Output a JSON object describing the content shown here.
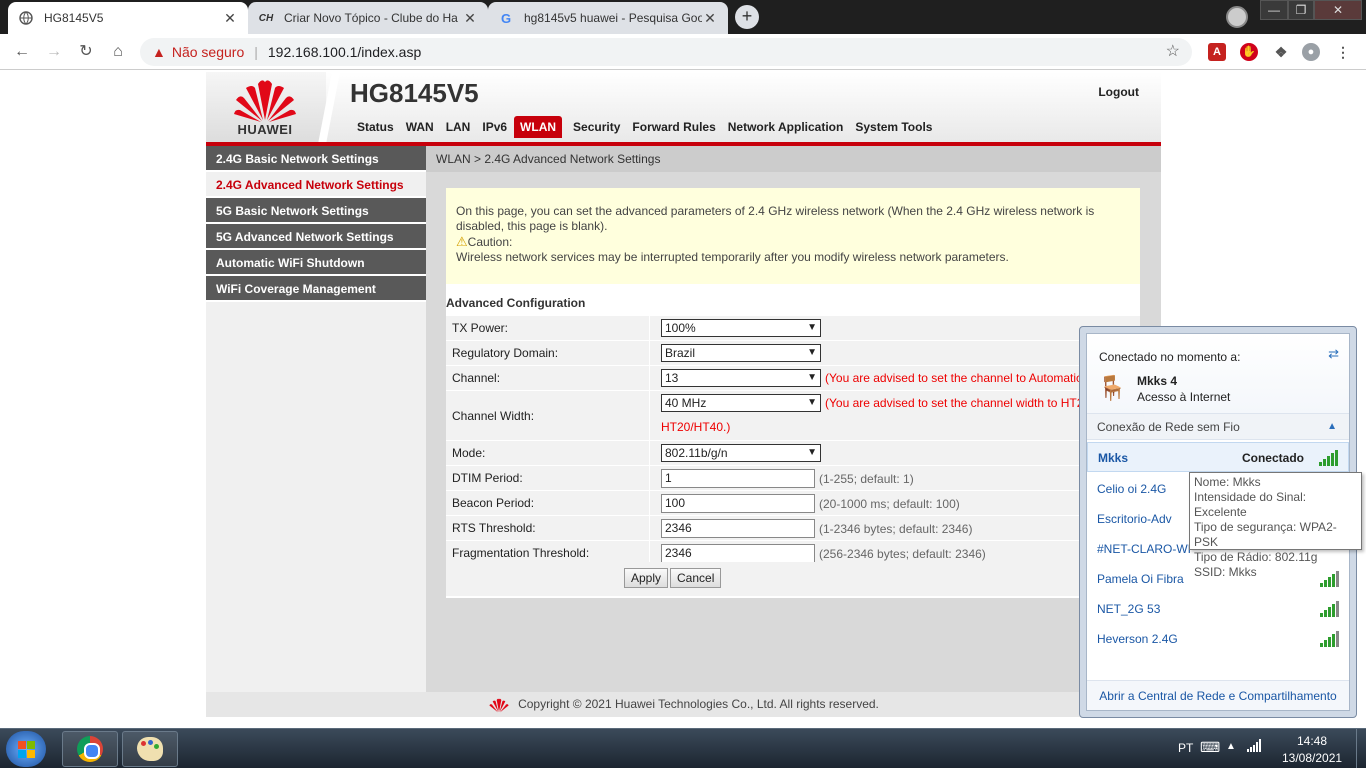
{
  "browser": {
    "tabs": [
      {
        "title": "HG8145V5",
        "favicon": "globe-icon"
      },
      {
        "title": "Criar Novo Tópico - Clube do Ha",
        "favicon_text": "CH"
      },
      {
        "title": "hg8145v5 huawei - Pesquisa Goo",
        "favicon_text": "G"
      }
    ],
    "new_tab": "+",
    "close": "✕",
    "security_label": "Não seguro",
    "url": "192.168.100.1/index.asp"
  },
  "router": {
    "brand": "HUAWEI",
    "model": "HG8145V5",
    "logout": "Logout",
    "nav": [
      "Status",
      "WAN",
      "LAN",
      "IPv6",
      "WLAN",
      "Security",
      "Forward Rules",
      "Network Application",
      "System Tools"
    ],
    "sidebar": [
      "2.4G Basic Network Settings",
      "2.4G Advanced Network Settings",
      "5G Basic Network Settings",
      "5G Advanced Network Settings",
      "Automatic WiFi Shutdown",
      "WiFi Coverage Management"
    ],
    "breadcrumb": "WLAN > 2.4G Advanced Network Settings",
    "notice": {
      "text": "On this page, you can set the advanced parameters of 2.4 GHz wireless network (When the 2.4 GHz wireless network is disabled, this page is blank).",
      "caution_label": "Caution:",
      "caution_text": "Wireless network services may be interrupted temporarily after you modify wireless network parameters."
    },
    "section_title": "Advanced Configuration",
    "fields": {
      "tx_power": {
        "label": "TX Power:",
        "value": "100%"
      },
      "regulatory": {
        "label": "Regulatory Domain:",
        "value": "Brazil"
      },
      "channel": {
        "label": "Channel:",
        "value": "13",
        "hint": "(You are advised to set the channel to Automatic"
      },
      "channel_width": {
        "label": "Channel Width:",
        "value": "40 MHz",
        "hint": "(You are advised to set the channel width to HT2",
        "hint2": "HT20/HT40.)"
      },
      "mode": {
        "label": "Mode:",
        "value": "802.11b/g/n"
      },
      "dtim": {
        "label": "DTIM Period:",
        "value": "1",
        "hint": "(1-255; default: 1)"
      },
      "beacon": {
        "label": "Beacon Period:",
        "value": "100",
        "hint": "(20-1000 ms; default: 100)"
      },
      "rts": {
        "label": "RTS Threshold:",
        "value": "2346",
        "hint": "(1-2346 bytes; default: 2346)"
      },
      "frag": {
        "label": "Fragmentation Threshold:",
        "value": "2346",
        "hint": "(256-2346 bytes; default: 2346)"
      }
    },
    "apply": "Apply",
    "cancel": "Cancel",
    "footer": "Copyright © 2021 Huawei Technologies Co., Ltd. All rights reserved."
  },
  "wifi_flyout": {
    "header": "Conectado no momento a:",
    "current_name": "Mkks  4",
    "current_status": "Acesso à Internet",
    "section": "Conexão de Rede sem Fio",
    "networks": [
      {
        "name": "Mkks",
        "state": "Conectado",
        "signal": 5
      },
      {
        "name": "Celio oi 2.4G",
        "signal": 4
      },
      {
        "name": "Escritorio-Adv",
        "signal": 4
      },
      {
        "name": "#NET-CLARO-WI",
        "signal": 4
      },
      {
        "name": "Pamela Oi Fibra",
        "signal": 4
      },
      {
        "name": "NET_2G 53",
        "signal": 4
      },
      {
        "name": "Heverson 2.4G",
        "signal": 4
      }
    ],
    "footer_link": "Abrir a Central de Rede e Compartilhamento",
    "tooltip": {
      "name": "Nome: Mkks",
      "signal": "Intensidade do Sinal: Excelente",
      "security": "Tipo de segurança: WPA2-PSK",
      "radio": "Tipo de Rádio: 802.11g",
      "ssid": "SSID: Mkks"
    }
  },
  "taskbar": {
    "language": "PT",
    "time": "14:48",
    "date": "13/08/2021"
  }
}
